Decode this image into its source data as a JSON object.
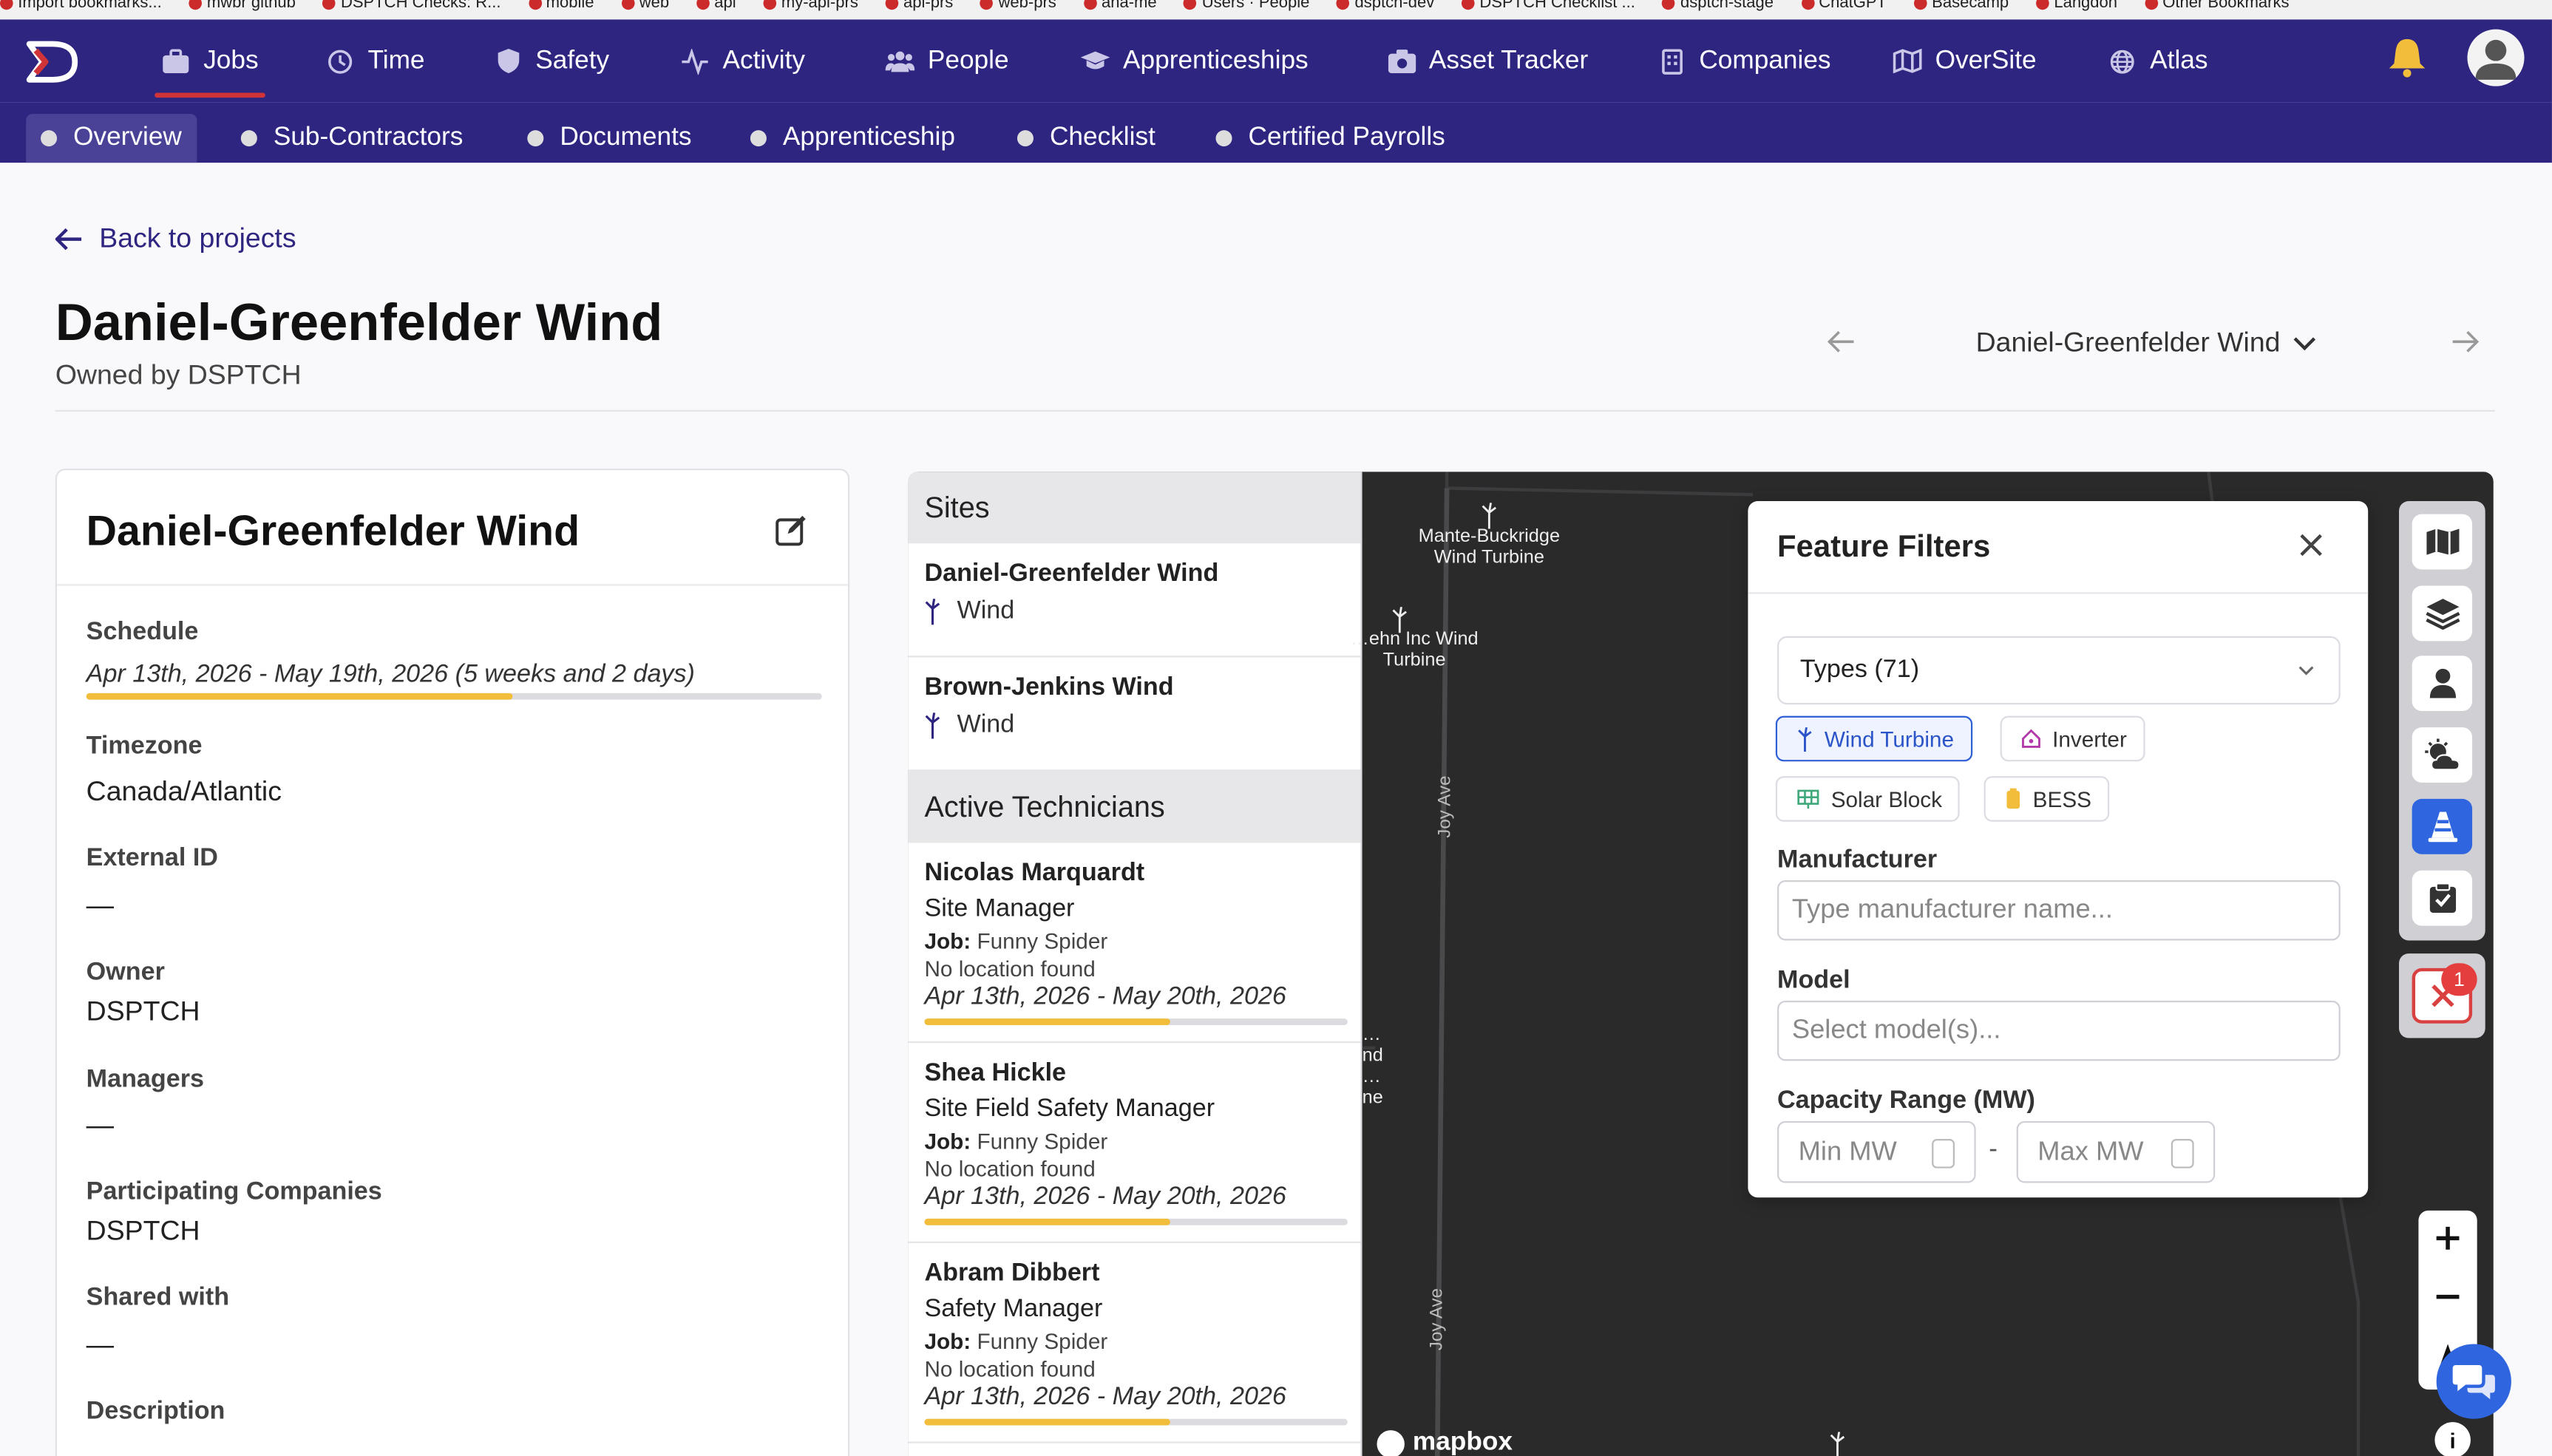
{
  "bookmarks": [
    "Import bookmarks...",
    "mwbr github",
    "DSPTCH Checks: R...",
    "mobile",
    "web",
    "api",
    "my-api-prs",
    "api-prs",
    "web-prs",
    "ana-me",
    "Users · People",
    "dsptch-dev",
    "DSPTCH Checklist ...",
    "dsptch-stage",
    "ChatGPT",
    "Basecamp",
    "Langdon",
    "Other Bookmarks"
  ],
  "nav": {
    "items": [
      {
        "label": "Jobs",
        "icon": "briefcase-icon"
      },
      {
        "label": "Time",
        "icon": "clock-icon"
      },
      {
        "label": "Safety",
        "icon": "shield-icon"
      },
      {
        "label": "Activity",
        "icon": "activity-icon"
      },
      {
        "label": "People",
        "icon": "people-icon"
      },
      {
        "label": "Apprenticeships",
        "icon": "graduation-cap-icon"
      },
      {
        "label": "Asset Tracker",
        "icon": "camera-icon"
      },
      {
        "label": "Companies",
        "icon": "building-icon"
      },
      {
        "label": "OverSite",
        "icon": "map-icon"
      },
      {
        "label": "Atlas",
        "icon": "globe-icon"
      }
    ],
    "active": "Jobs"
  },
  "subnav": {
    "items": [
      "Overview",
      "Sub-Contractors",
      "Documents",
      "Apprenticeship",
      "Checklist",
      "Certified Payrolls"
    ],
    "active": "Overview"
  },
  "header": {
    "back_label": "Back to projects",
    "title": "Daniel-Greenfelder Wind",
    "owned_by": "Owned by DSPTCH",
    "project_select": "Daniel-Greenfelder Wind"
  },
  "details": {
    "title": "Daniel-Greenfelder Wind",
    "schedule_label": "Schedule",
    "schedule_value": "Apr 13th, 2026 - May 19th, 2026 (5 weeks and 2 days)",
    "schedule_progress": 0.58,
    "timezone_label": "Timezone",
    "timezone_value": "Canada/Atlantic",
    "external_id_label": "External ID",
    "external_id_value": "—",
    "owner_label": "Owner",
    "owner_value": "DSPTCH",
    "managers_label": "Managers",
    "managers_value": "—",
    "participating_label": "Participating Companies",
    "participating_value": "DSPTCH",
    "shared_label": "Shared with",
    "shared_value": "—",
    "description_label": "Description"
  },
  "sites": {
    "header": "Sites",
    "items": [
      {
        "name": "Daniel-Greenfelder Wind",
        "type": "Wind"
      },
      {
        "name": "Brown-Jenkins Wind",
        "type": "Wind"
      }
    ]
  },
  "technicians": {
    "header": "Active Technicians",
    "job_prefix": "Job:",
    "items": [
      {
        "name": "Nicolas Marquardt",
        "role": "Site Manager",
        "job": "Funny Spider",
        "location": "No location found",
        "dates": "Apr 13th, 2026 - May 20th, 2026",
        "progress": 0.58
      },
      {
        "name": "Shea Hickle",
        "role": "Site Field Safety Manager",
        "job": "Funny Spider",
        "location": "No location found",
        "dates": "Apr 13th, 2026 - May 20th, 2026",
        "progress": 0.58
      },
      {
        "name": "Abram Dibbert",
        "role": "Safety Manager",
        "job": "Funny Spider",
        "location": "No location found",
        "dates": "Apr 13th, 2026 - May 20th, 2026",
        "progress": 0.58
      }
    ]
  },
  "map": {
    "labels": [
      "Mante-Buckridge Wind Turbine",
      "…ehn Inc Wind Turbine",
      "…nd …ne"
    ],
    "road_1": "Joy Ave",
    "road_2": "Joy Ave",
    "attribution": "mapbox"
  },
  "filters": {
    "title": "Feature Filters",
    "types_label": "Types (71)",
    "chips": [
      {
        "label": "Wind Turbine",
        "selected": true
      },
      {
        "label": "Inverter",
        "selected": false
      },
      {
        "label": "Solar Block",
        "selected": false
      },
      {
        "label": "BESS",
        "selected": false
      }
    ],
    "manufacturer_label": "Manufacturer",
    "manufacturer_placeholder": "Type manufacturer name...",
    "model_label": "Model",
    "model_placeholder": "Select model(s)...",
    "capacity_label": "Capacity Range (MW)",
    "min_placeholder": "Min MW",
    "max_placeholder": "Max MW",
    "range_separator": "-"
  },
  "tools": {
    "filter_badge": "1"
  },
  "colors": {
    "nav_bg": "#2e2581",
    "accent_red": "#d03438",
    "progress": "#f2bd3a",
    "primary_blue": "#2f66e0"
  }
}
